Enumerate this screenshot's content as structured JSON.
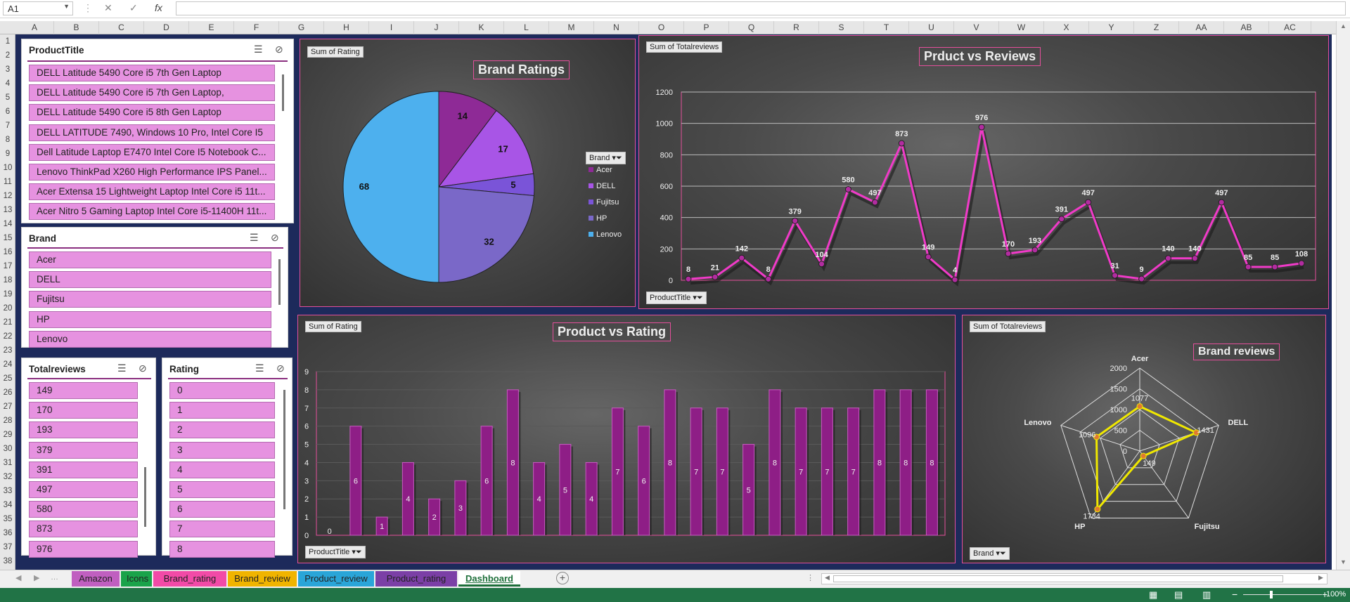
{
  "namebox": "A1",
  "columns": [
    "A",
    "B",
    "C",
    "D",
    "E",
    "F",
    "G",
    "H",
    "I",
    "J",
    "K",
    "L",
    "M",
    "N",
    "O",
    "P",
    "Q",
    "R",
    "S",
    "T",
    "U",
    "V",
    "W",
    "X",
    "Y",
    "Z",
    "AA",
    "AB",
    "AC"
  ],
  "rows": [
    "1",
    "2",
    "3",
    "4",
    "5",
    "6",
    "7",
    "8",
    "9",
    "10",
    "11",
    "12",
    "13",
    "14",
    "15",
    "16",
    "17",
    "18",
    "19",
    "20",
    "21",
    "22",
    "23",
    "24",
    "25",
    "26",
    "27",
    "28",
    "29",
    "30",
    "31",
    "32",
    "33",
    "34",
    "35",
    "36",
    "37",
    "38"
  ],
  "slicers": {
    "product": {
      "title": "ProductTitle",
      "items": [
        "DELL Latitude 5490 Core i5 7th Gen Laptop",
        "DELL Latitude 5490 Core i5 7th Gen Laptop,",
        "DELL Latitude 5490 Core i5 8th Gen Laptop",
        "DELL LATITUDE 7490, Windows 10 Pro, Intel Core I5",
        "Dell Latitude Laptop E7470 Intel Core I5 Notebook C...",
        "Lenovo ThinkPad X260 High Performance  IPS Panel...",
        "Acer Extensa 15 Lightweight Laptop Intel Core i5 11t...",
        "Acer Nitro 5 Gaming Laptop Intel Core i5-11400H 11t..."
      ]
    },
    "brand": {
      "title": "Brand",
      "items": [
        "Acer",
        "DELL",
        "Fujitsu",
        "HP",
        "Lenovo"
      ]
    },
    "totalreviews": {
      "title": "Totalreviews",
      "items": [
        "149",
        "170",
        "193",
        "379",
        "391",
        "497",
        "580",
        "873",
        "976"
      ]
    },
    "rating": {
      "title": "Rating",
      "items": [
        "0",
        "1",
        "2",
        "3",
        "4",
        "5",
        "6",
        "7",
        "8"
      ]
    }
  },
  "charts": {
    "pie": {
      "field": "Sum of Rating",
      "title": "Brand Ratings",
      "legend_field": "Brand"
    },
    "line": {
      "field": "Sum of Totalreviews",
      "title": "Prduct vs Reviews",
      "axis_field": "ProductTitle"
    },
    "bar": {
      "field": "Sum of Rating",
      "title": "Product vs Rating",
      "axis_field": "ProductTitle"
    },
    "radar": {
      "field": "Sum of Totalreviews",
      "title": "Brand reviews",
      "axis_field": "Brand"
    }
  },
  "chart_data": [
    {
      "type": "pie",
      "title": "Brand Ratings",
      "categories": [
        "Acer",
        "DELL",
        "Fujitsu",
        "HP",
        "Lenovo"
      ],
      "values": [
        14,
        17,
        5,
        32,
        68
      ],
      "colors": [
        "#8e2a96",
        "#a855e6",
        "#7a54d8",
        "#7a68c8",
        "#4db0ee"
      ]
    },
    {
      "type": "line",
      "title": "Prduct vs Reviews",
      "values": [
        8,
        21,
        142,
        8,
        379,
        104,
        580,
        497,
        873,
        149,
        4,
        976,
        170,
        193,
        391,
        497,
        31,
        9,
        140,
        140,
        497,
        85,
        85,
        108
      ],
      "ylim": [
        0,
        1200
      ],
      "yticks": [
        "0",
        "200",
        "400",
        "600",
        "800",
        "1000",
        "1200"
      ]
    },
    {
      "type": "bar",
      "title": "Product vs Rating",
      "values": [
        0,
        6,
        1,
        4,
        2,
        3,
        6,
        8,
        4,
        5,
        4,
        7,
        6,
        8,
        7,
        7,
        5,
        8,
        7,
        7,
        7,
        8,
        8,
        8
      ],
      "ylim": [
        0,
        9
      ],
      "yticks": [
        "0",
        "1",
        "2",
        "3",
        "4",
        "5",
        "6",
        "7",
        "8",
        "9"
      ]
    },
    {
      "type": "radar",
      "title": "Brand reviews",
      "categories": [
        "Acer",
        "DELL",
        "Fujitsu",
        "HP",
        "Lenovo"
      ],
      "values": [
        1077,
        1431,
        149,
        1734,
        1096
      ],
      "rlim": [
        0,
        2000
      ],
      "rticks": [
        "0",
        "500",
        "1000",
        "1500",
        "2000"
      ]
    }
  ],
  "tabs": [
    {
      "label": "Amazon",
      "color": "#c05fc0"
    },
    {
      "label": "Icons",
      "color": "#1aa34a"
    },
    {
      "label": "Brand_rating",
      "color": "#f24aa7"
    },
    {
      "label": "Brand_review",
      "color": "#f0b400"
    },
    {
      "label": "Product_review",
      "color": "#2aa5d8"
    },
    {
      "label": "Product_rating",
      "color": "#7b3fa6"
    },
    {
      "label": "Dashboard",
      "color": "#ffffff"
    }
  ],
  "zoom": "100%"
}
